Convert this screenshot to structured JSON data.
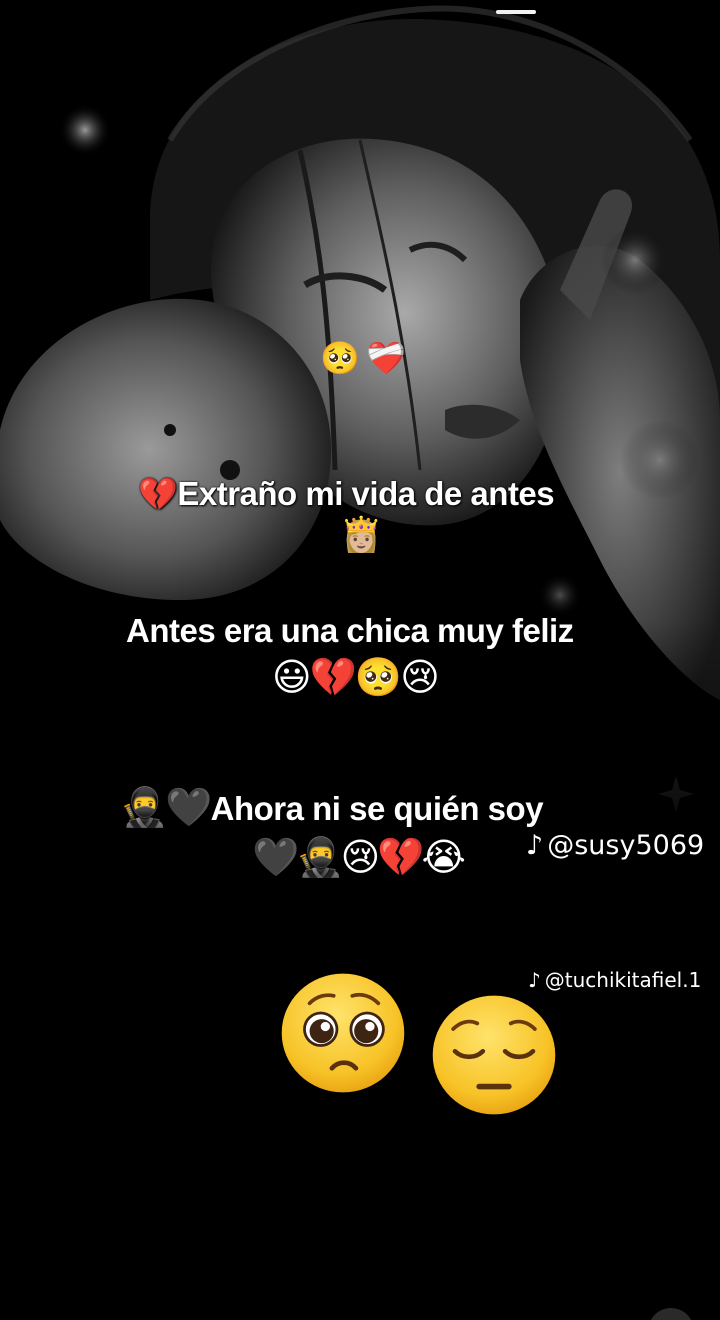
{
  "lines": {
    "line1": "Extraño mi vida de antes",
    "line2": "Antes era una chica muy feliz",
    "line3": "Ahora ni se quién soy"
  },
  "emojis": {
    "face_small": "🥺",
    "heart_small": "❤️‍🩹",
    "line1_lead": "💔",
    "crown_row": "👸🏼",
    "row2": "😃💔🥺😢",
    "line3_lead": "🥷🖤",
    "row3": "🖤🥷😢💔😭"
  },
  "watermarks": {
    "primary": "@susy5069",
    "secondary": "@tuchikitafiel.1",
    "logo_glyph": "♪"
  },
  "icons": [
    "tiktok-icon",
    "pleading-face-icon",
    "pensive-face-icon"
  ],
  "colors": {
    "background": "#000000",
    "text": "#ffffff",
    "emoji_yellow": "#f7c327"
  }
}
